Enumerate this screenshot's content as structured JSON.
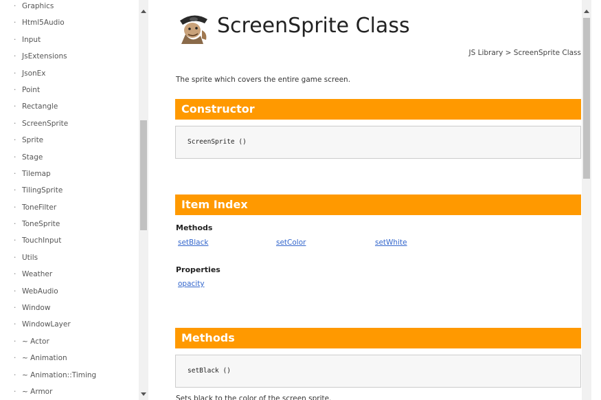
{
  "sidebar": {
    "bullet": "·",
    "items": [
      "Graphics",
      "Html5Audio",
      "Input",
      "JsExtensions",
      "JsonEx",
      "Point",
      "Rectangle",
      "ScreenSprite",
      "Sprite",
      "Stage",
      "Tilemap",
      "TilingSprite",
      "ToneFilter",
      "ToneSprite",
      "TouchInput",
      "Utils",
      "Weather",
      "WebAudio",
      "Window",
      "WindowLayer",
      "~ Actor",
      "~ Animation",
      "~ Animation::Timing",
      "~ Armor"
    ]
  },
  "header": {
    "title": "ScreenSprite Class",
    "breadcrumb": "JS Library > ScreenSprite Class"
  },
  "description": "The sprite which covers the entire game screen.",
  "constructor": {
    "heading": "Constructor",
    "signature": "ScreenSprite ()"
  },
  "item_index": {
    "heading": "Item Index",
    "methods_label": "Methods",
    "methods": [
      "setBlack",
      "setColor",
      "setWhite"
    ],
    "properties_label": "Properties",
    "properties": [
      "opacity"
    ]
  },
  "methods_section": {
    "heading": "Methods",
    "first_signature": "setBlack ()",
    "first_description": "Sets black to the color of the screen sprite."
  },
  "colors": {
    "accent": "#ff9900",
    "link": "#3366cc"
  },
  "icons": {
    "logo": "pirate-character-logo"
  }
}
